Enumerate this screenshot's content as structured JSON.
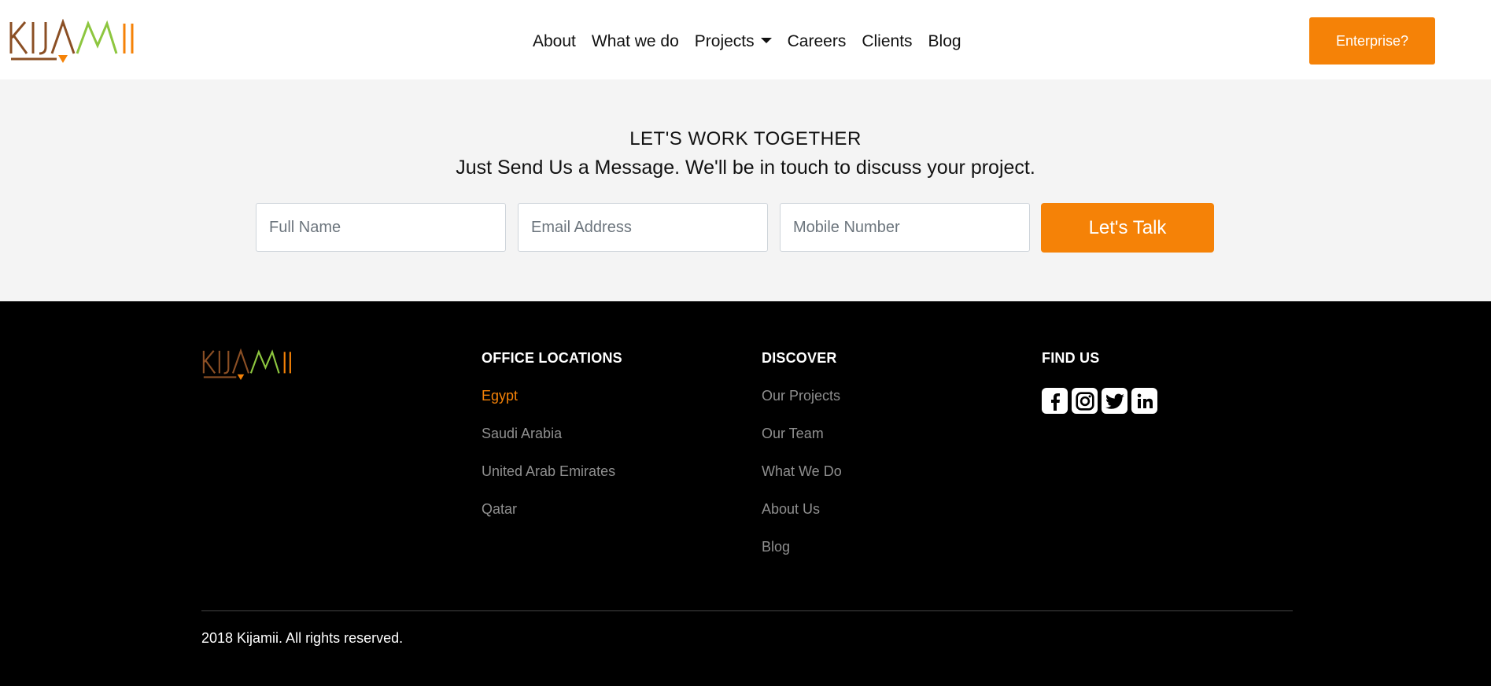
{
  "brand": {
    "logo_text": "KIJAMII",
    "colors": {
      "brown": "#8b4f24",
      "orange": "#f58207",
      "green": "#8dc63f"
    }
  },
  "nav": {
    "items": [
      {
        "label": "About"
      },
      {
        "label": "What we do"
      },
      {
        "label": "Projects",
        "has_dropdown": true
      },
      {
        "label": "Careers"
      },
      {
        "label": "Clients"
      },
      {
        "label": "Blog"
      }
    ],
    "enterprise_label": "Enterprise?"
  },
  "contact": {
    "title": "LET'S WORK TOGETHER",
    "subtitle": "Just Send Us a Message. We'll be in touch to discuss your project.",
    "fields": {
      "full_name_placeholder": "Full Name",
      "email_placeholder": "Email Address",
      "mobile_placeholder": "Mobile Number"
    },
    "submit_label": "Let's Talk"
  },
  "footer": {
    "office": {
      "heading": "OFFICE LOCATIONS",
      "items": [
        "Egypt",
        "Saudi Arabia",
        "United Arab Emirates",
        "Qatar"
      ],
      "active_index": 0
    },
    "discover": {
      "heading": "DISCOVER",
      "items": [
        "Our Projects",
        "Our Team",
        "What We Do",
        "About Us",
        "Blog"
      ]
    },
    "find_us": {
      "heading": "FIND US",
      "icons": [
        "facebook-icon",
        "instagram-icon",
        "twitter-icon",
        "linkedin-icon"
      ]
    },
    "copyright": "2018 Kijamii. All rights reserved."
  }
}
